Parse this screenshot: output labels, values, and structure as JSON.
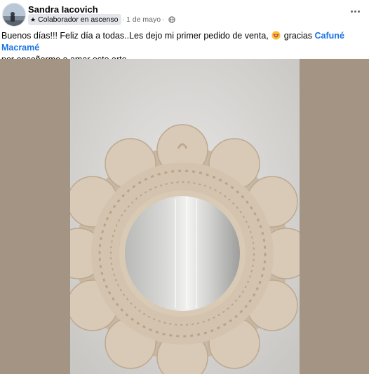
{
  "post": {
    "author": "Sandra Iacovich",
    "badge": "Colaborador en ascenso",
    "separator": "·",
    "date": "1 de mayo",
    "text_part1": "Buenos días!!! Feliz día a todas..Les dejo mi primer pedido de venta,",
    "text_part2": "gracias",
    "page_link": "Cafuné Macramé",
    "text_part3": "por enseñarme a amar este arte."
  },
  "icons": {
    "badge": "star-icon",
    "audience": "globe-icon",
    "menu": "more-options-icon",
    "emoji": "heart-eyes-emoji"
  },
  "colors": {
    "link": "#1b74e4",
    "secondary_text": "#65676b",
    "badge_bg": "#e4e6eb",
    "media_bg": "#a39484"
  }
}
